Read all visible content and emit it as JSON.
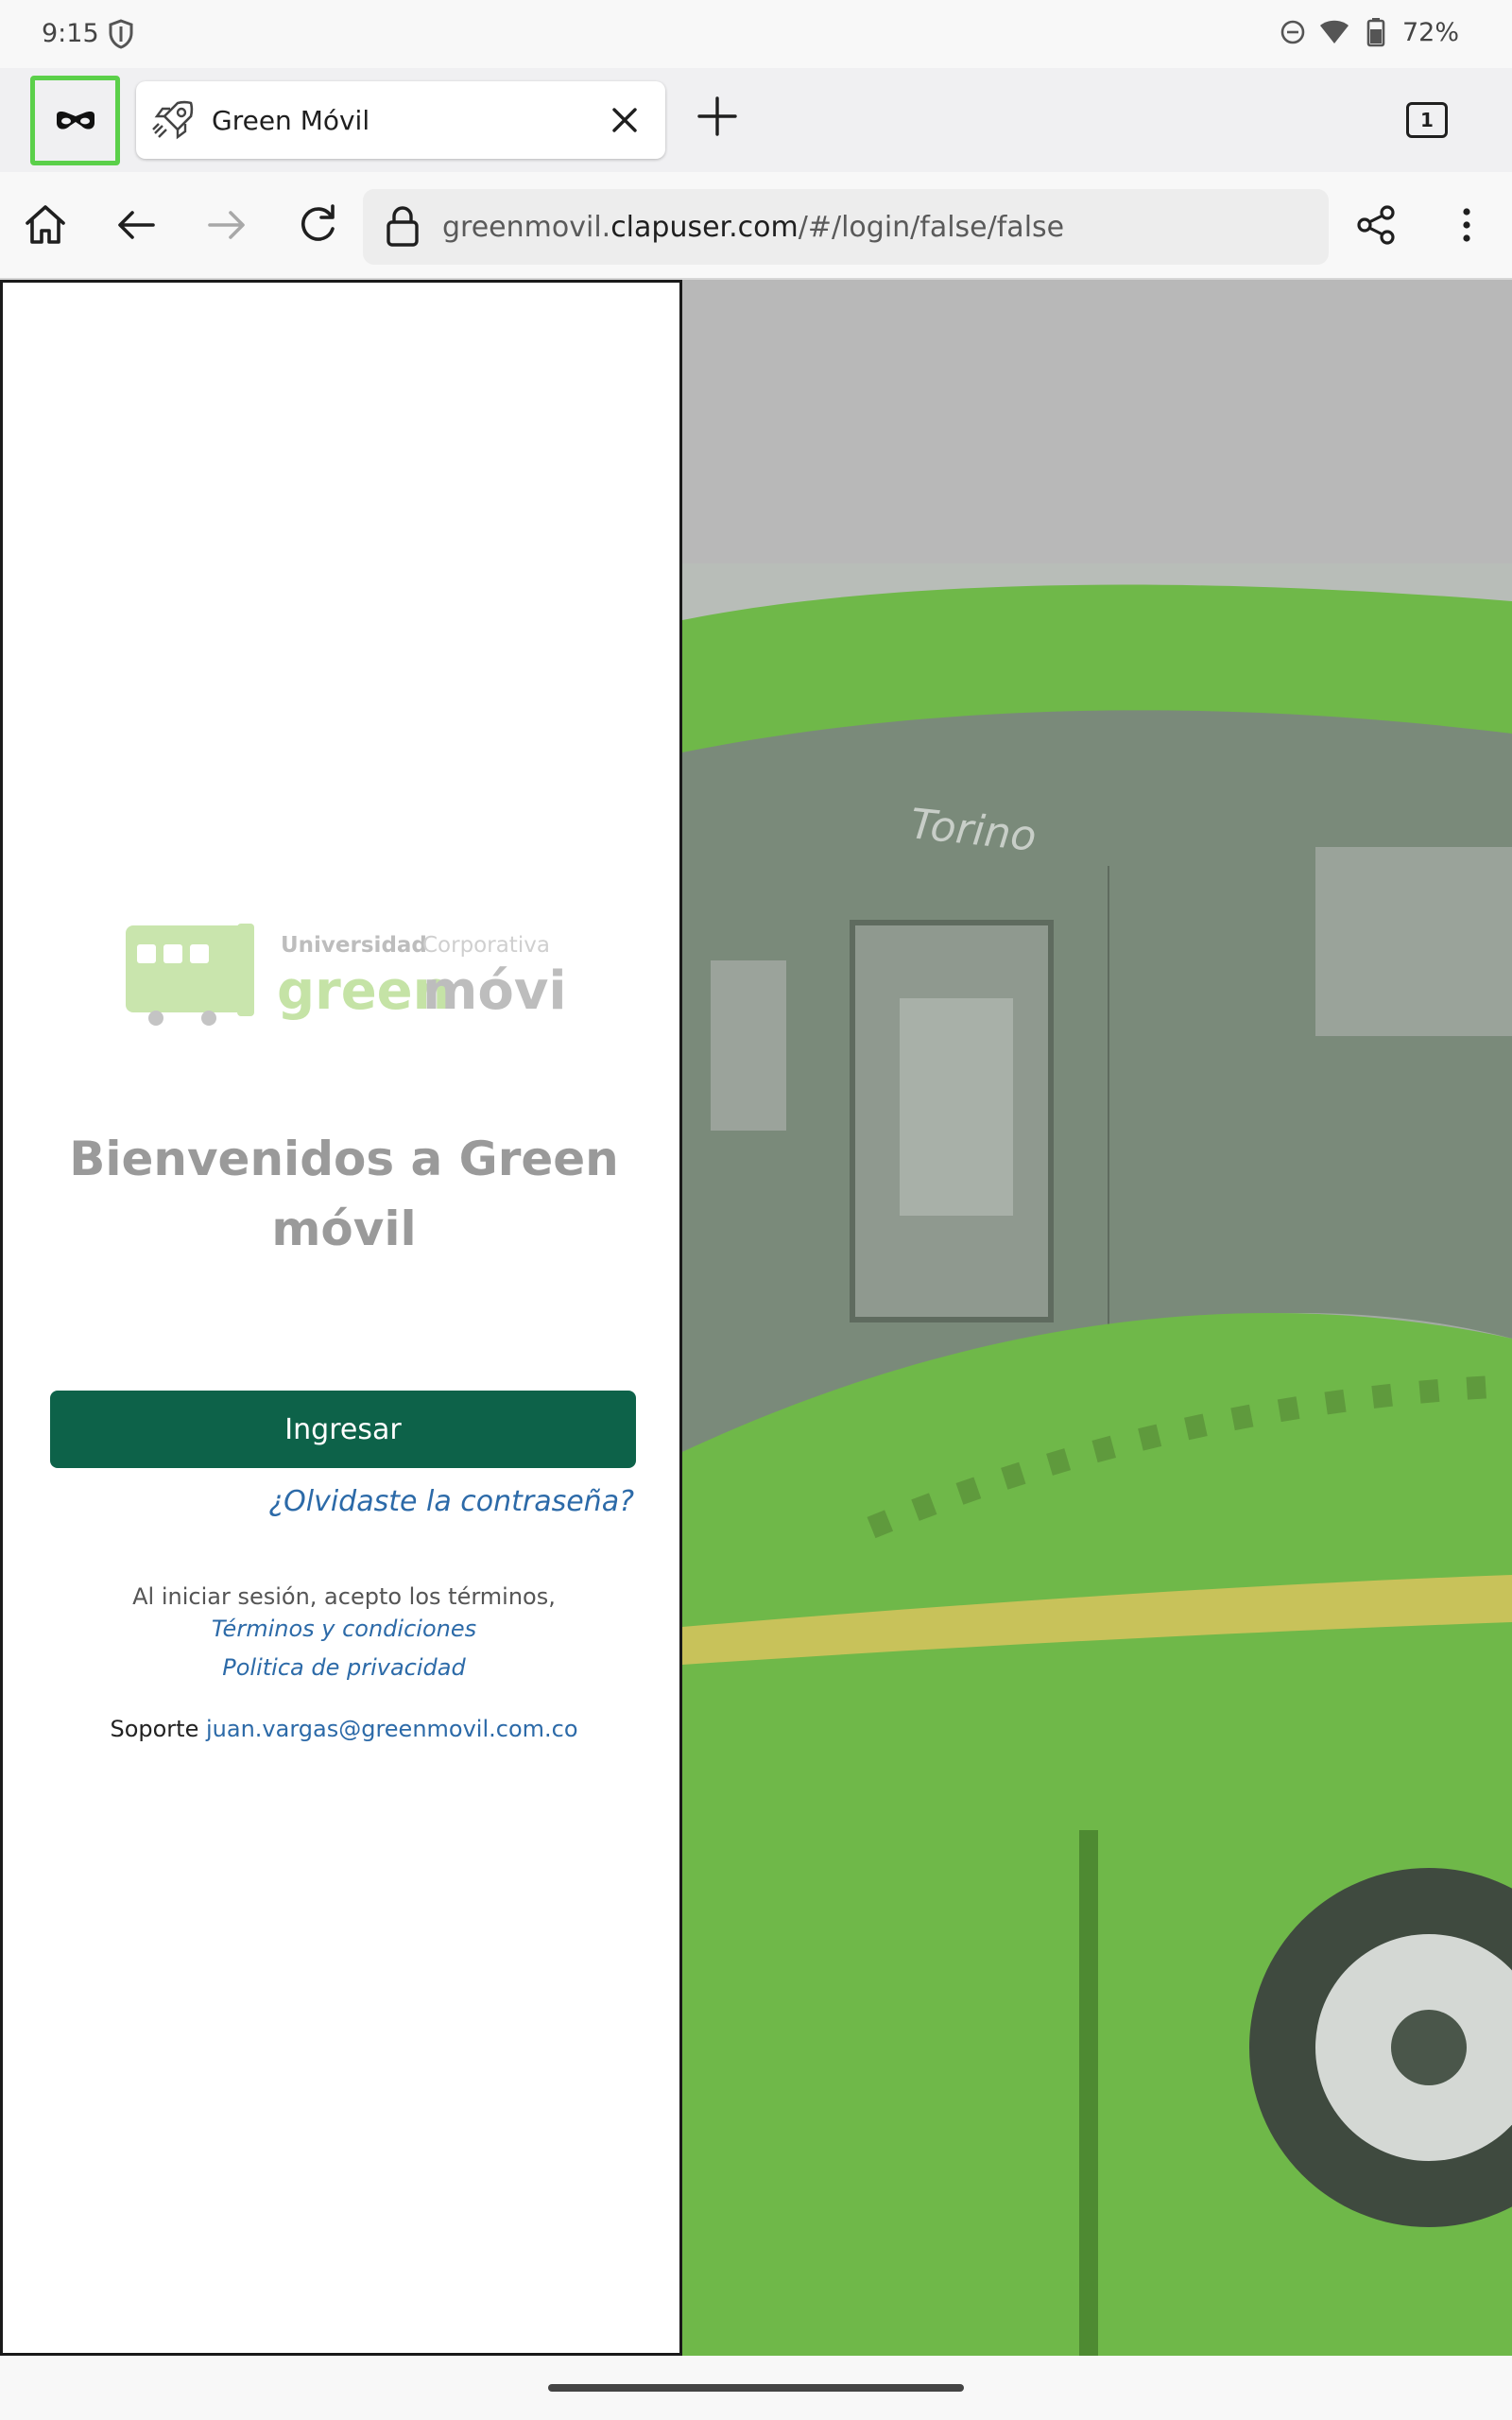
{
  "status_bar": {
    "time": "9:15",
    "battery": "72%",
    "icons": [
      "shield-icon",
      "dnd-icon",
      "wifi-icon",
      "battery-icon"
    ]
  },
  "tabs": {
    "private_mode_icon": "mask-icon",
    "active_tab": {
      "title": "Green Móvil",
      "icon": "rocket-icon"
    },
    "tab_count": "1"
  },
  "toolbar": {
    "url_domain_prefix": "greenmovil.",
    "url_domain": "clapuser.com",
    "url_path": "/#/login/false/false",
    "icons": [
      "home-icon",
      "back-icon",
      "forward-icon",
      "reload-icon",
      "lock-icon",
      "share-icon",
      "menu-icon"
    ]
  },
  "login": {
    "logo_line1": "Universidad",
    "logo_line1b": "Corporativa",
    "logo_green": "green",
    "logo_movil": "móvil",
    "welcome": "Bienvenidos a Green móvil",
    "login_button": "Ingresar",
    "forgot_password": "¿Olvidaste la contraseña?",
    "terms_intro": "Al iniciar sesión, acepto los términos,",
    "terms_link": "Términos y condiciones",
    "privacy_link": "Politica de privacidad",
    "support_label": "Soporte",
    "support_email": "juan.vargas@greenmovil.com.co"
  },
  "hero": {
    "bus_brand": "Torino"
  },
  "colors": {
    "primary_button": "#0d6249",
    "link": "#2c6aa8",
    "private_highlight": "#5bd04a",
    "bus_green": "#6fb849"
  }
}
